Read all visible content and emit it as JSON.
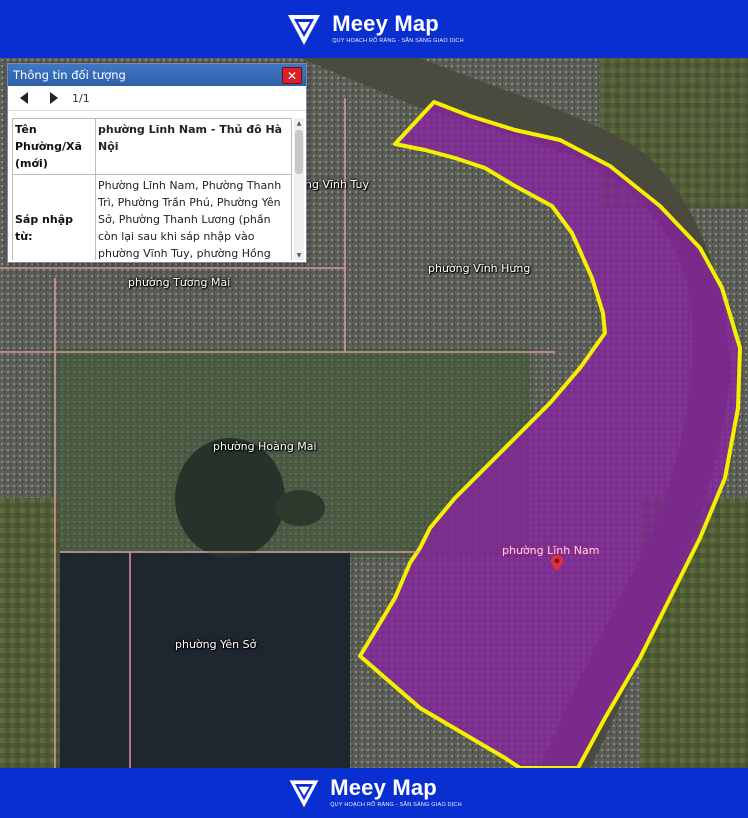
{
  "brand": {
    "name": "Meey Map",
    "tagline": "QUY HOẠCH RÕ RÀNG - SẴN SÀNG GIAO DỊCH"
  },
  "colors": {
    "banner": "#0a2fd0",
    "highlight_fill": "#8a1fa8",
    "highlight_border": "#f4f000",
    "popup_header": "#3569b4",
    "close": "#d8222a"
  },
  "popup": {
    "title": "Thông tin đối tượng",
    "page_indicator": "1/1",
    "rows": [
      {
        "key": "Tên Phường/Xã (mới)",
        "value": "phường Lĩnh Nam - Thủ đô Hà Nội"
      },
      {
        "key": "Sáp nhập từ:",
        "value": "Phường Lĩnh Nam, Phường Thanh Trì, Phường Trần Phú, Phường Yên Sở, Phường Thanh Lương (phần còn lại sau khi sáp nhập vào phường Vĩnh Tuy, phường Hồng Hà)"
      }
    ]
  },
  "map": {
    "labels": {
      "vinh_tuy": "ng Vĩnh Tuy",
      "vinh_hung": "phường Vĩnh Hưng",
      "tuong_mai": "phường Tương Mai",
      "hoang_mai": "phường Hoàng Mai",
      "linh_nam": "phường Lĩnh Nam",
      "yen_so": "phường Yên Sở"
    },
    "selected_area": "phường Lĩnh Nam"
  }
}
